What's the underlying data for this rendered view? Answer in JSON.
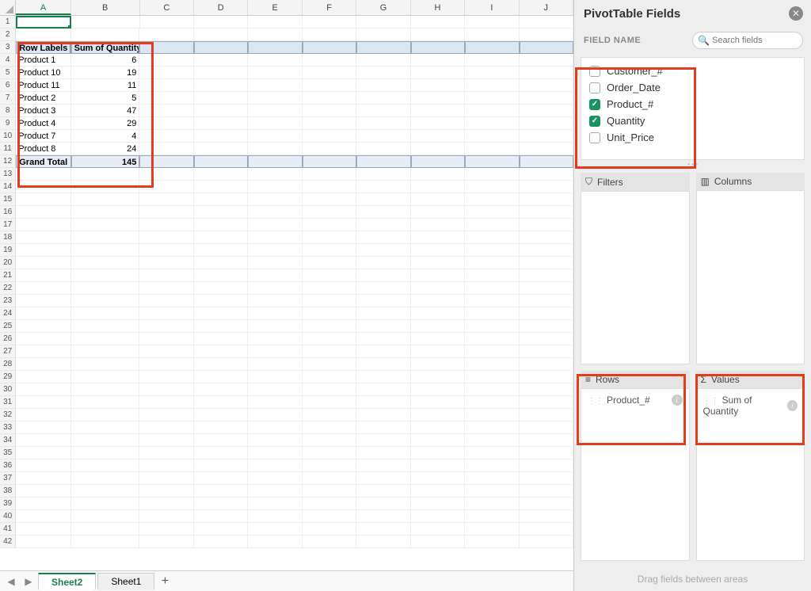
{
  "columns": [
    "A",
    "B",
    "C",
    "D",
    "E",
    "F",
    "G",
    "H",
    "I",
    "J"
  ],
  "pivot": {
    "header_row_labels": "Row Labels",
    "header_sum": "Sum of Quantity",
    "rows": [
      {
        "label": "Product 1",
        "value": "6"
      },
      {
        "label": "Product 10",
        "value": "19"
      },
      {
        "label": "Product 11",
        "value": "11"
      },
      {
        "label": "Product 2",
        "value": "5"
      },
      {
        "label": "Product 3",
        "value": "47"
      },
      {
        "label": "Product 4",
        "value": "29"
      },
      {
        "label": "Product 7",
        "value": "4"
      },
      {
        "label": "Product 8",
        "value": "24"
      }
    ],
    "grand_label": "Grand Total",
    "grand_value": "145"
  },
  "tabs": {
    "active": "Sheet2",
    "other": "Sheet1"
  },
  "panel": {
    "title": "PivotTable Fields",
    "field_name_label": "FIELD NAME",
    "search_placeholder": "Search fields",
    "fields": [
      {
        "name": "Customer_#",
        "checked": false
      },
      {
        "name": "Order_Date",
        "checked": false
      },
      {
        "name": "Product_#",
        "checked": true
      },
      {
        "name": "Quantity",
        "checked": true
      },
      {
        "name": "Unit_Price",
        "checked": false
      }
    ],
    "areas": {
      "filters": "Filters",
      "columns": "Columns",
      "rows": "Rows",
      "values": "Values",
      "rows_pill": "Product_#",
      "values_pill": "Sum of Quantity"
    },
    "drag_hint": "Drag fields between areas"
  }
}
